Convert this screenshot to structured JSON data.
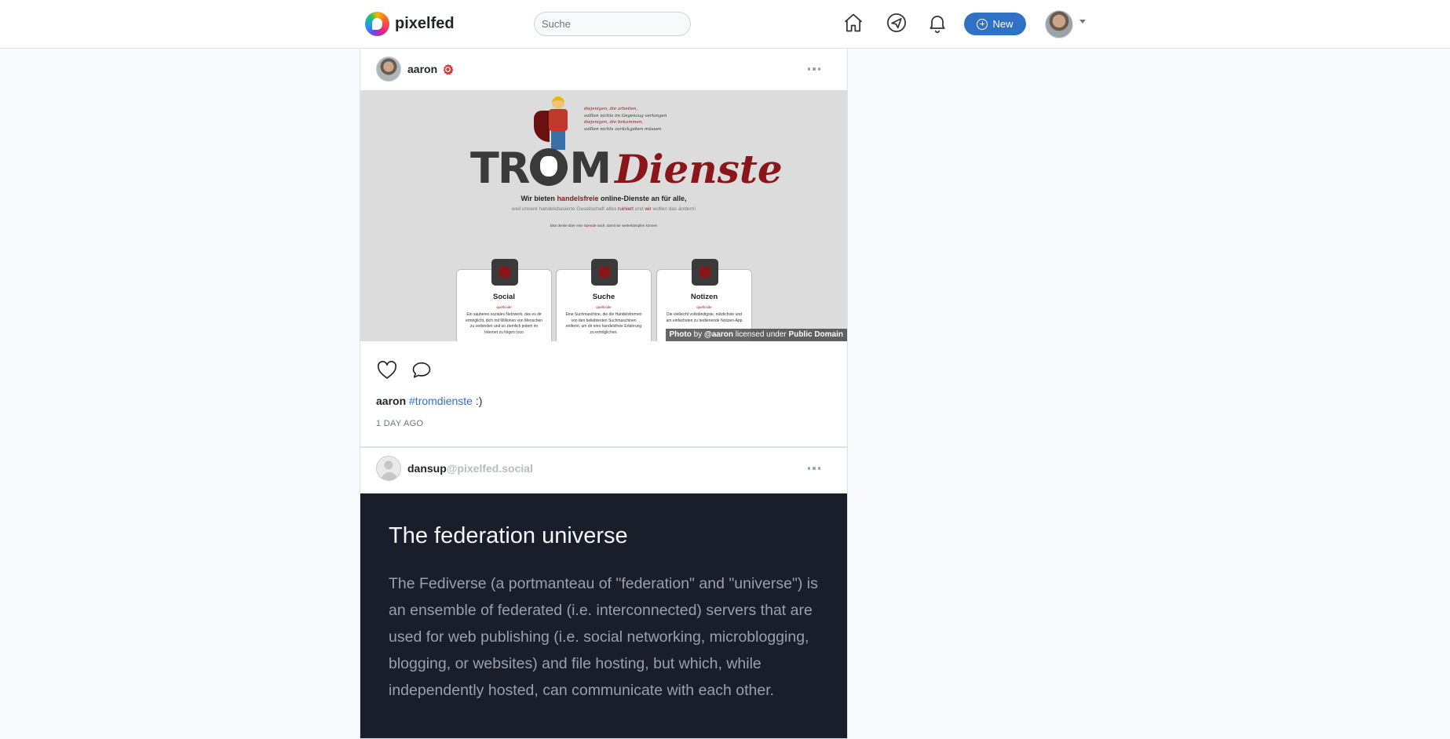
{
  "brand": {
    "name": "pixelfed"
  },
  "search": {
    "placeholder": "Suche"
  },
  "nav": {
    "new_label": "New"
  },
  "posts": [
    {
      "username": "aaron",
      "domain": "",
      "image": {
        "logo_left": "TR",
        "logo_right": "M",
        "logo_accent": "Dienste",
        "tagline": [
          "diejenigen, die arbeiten,",
          "sollten nichts im Gegenzug verlangen",
          "diejenigen, die bekommen,",
          "sollten nichts zurückgeben müssen"
        ],
        "line1_a": "Wir bieten ",
        "line1_b": "handelsfreie",
        "line1_c": " online-Dienste an für alle,",
        "line2_a": "weil unsere handelsbasierte Gesellschaft alles ",
        "line2_b": "ruiniert",
        "line2_c": " und ",
        "line2_d": "wir",
        "line2_e": " wollen das ändern!",
        "line3_a": "bitte denke über eine ",
        "line3_b": "Spende",
        "line3_c": " nach, damit wir weiterkämpfen können",
        "services": [
          {
            "title": "Social",
            "sub": "quellcode",
            "desc": "Ein sauberes soziales Netzwerk, das es dir ermöglicht, dich mit Millionen von Menschen zu verbinden und so ziemlich jedem im Internet zu folgen (von"
          },
          {
            "title": "Suche",
            "sub": "quellcode",
            "desc": "Eine Suchmaschine, die die Handelsformen von den beliebtesten Suchmaschinen entfernt, um dir eine handelsfreie Erfahrung zu ermöglichen."
          },
          {
            "title": "Notizen",
            "sub": "quellcode",
            "desc": "Die vielleicht vollständigste, nützlichste und am einfachsten zu bedienende Notizen-App"
          }
        ],
        "credit_a": "Photo",
        "credit_b": " by ",
        "credit_c": "@aaron",
        "credit_d": " licensed under ",
        "credit_e": "Public Domain"
      },
      "caption_user": "aaron",
      "caption_tag": "#tromdienste",
      "caption_text": " :)",
      "timestamp": "1 DAY AGO"
    },
    {
      "username": "dansup",
      "domain": "@pixelfed.social",
      "embed_title": "The federation universe",
      "embed_body": "The Fediverse (a portmanteau of \"federation\" and \"universe\") is an ensemble of federated (i.e. interconnected) servers that are used for web publishing (i.e. social networking, microblogging, blogging, or websites) and file hosting, but which, while independently hosted, can communicate with each other."
    }
  ],
  "colors": {
    "accent": "#3070c5",
    "verified": "#d23c3c",
    "brand_red": "#8a1619",
    "dark_panel": "#1a1e2b"
  },
  "icons": [
    "home-icon",
    "discover-icon",
    "bell-icon",
    "plus-circle-icon",
    "heart-icon",
    "comment-icon",
    "more-icon",
    "verified-icon"
  ]
}
